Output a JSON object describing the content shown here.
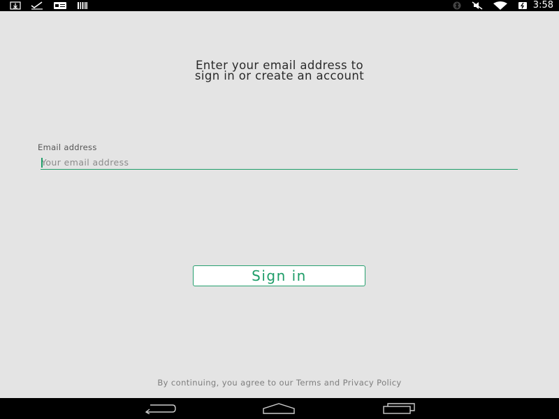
{
  "status_bar": {
    "time": "3:58",
    "left_icons": [
      "download-icon",
      "check-icon",
      "message-icon",
      "barcode-icon"
    ],
    "right_icons": [
      "bluetooth-icon",
      "mute-icon",
      "wifi-icon",
      "battery-charging-icon"
    ]
  },
  "heading": {
    "line1": "Enter your email address to",
    "line2": "sign in or create an account"
  },
  "email": {
    "label": "Email address",
    "placeholder": "Your email address",
    "value": ""
  },
  "signin_button": {
    "label": "Sign in"
  },
  "footer": {
    "terms_text": "By continuing, you agree to our Terms and Privacy Policy"
  },
  "nav_bar": {
    "buttons": [
      "back-icon",
      "home-icon",
      "recents-icon"
    ]
  },
  "colors": {
    "accent": "#1e9d68",
    "background": "#e4e4e4",
    "bars": "#000000"
  }
}
